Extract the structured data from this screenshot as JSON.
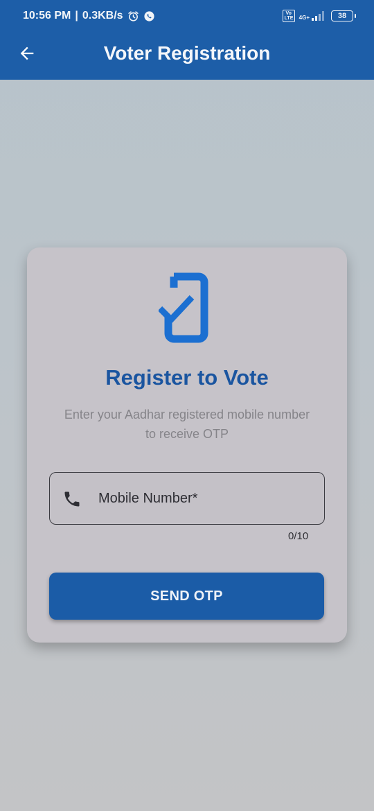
{
  "status_bar": {
    "time": "10:56 PM",
    "network_speed": "0.3KB/s",
    "separator": "|",
    "volte_label": "Vo LTE",
    "network_type": "4G+",
    "battery_level": "38",
    "icons": [
      "alarm-icon",
      "whatsapp-icon",
      "signal-icon",
      "battery-icon"
    ]
  },
  "app_bar": {
    "title": "Voter Registration",
    "back_icon": "arrow-back-icon",
    "color": "#1d5ea8"
  },
  "card": {
    "icon": "mobile-check-icon",
    "title": "Register to Vote",
    "subtitle_line1": "Enter your Aadhar registered mobile number",
    "subtitle_line2": "to receive OTP",
    "mobile_field": {
      "placeholder": "Mobile Number*",
      "value": "",
      "icon": "phone-icon",
      "counter": "0/10"
    },
    "send_button_label": "SEND OTP"
  },
  "colors": {
    "accent": "#1b5ca7",
    "title": "#1a55a0",
    "subtitle": "#858489"
  }
}
